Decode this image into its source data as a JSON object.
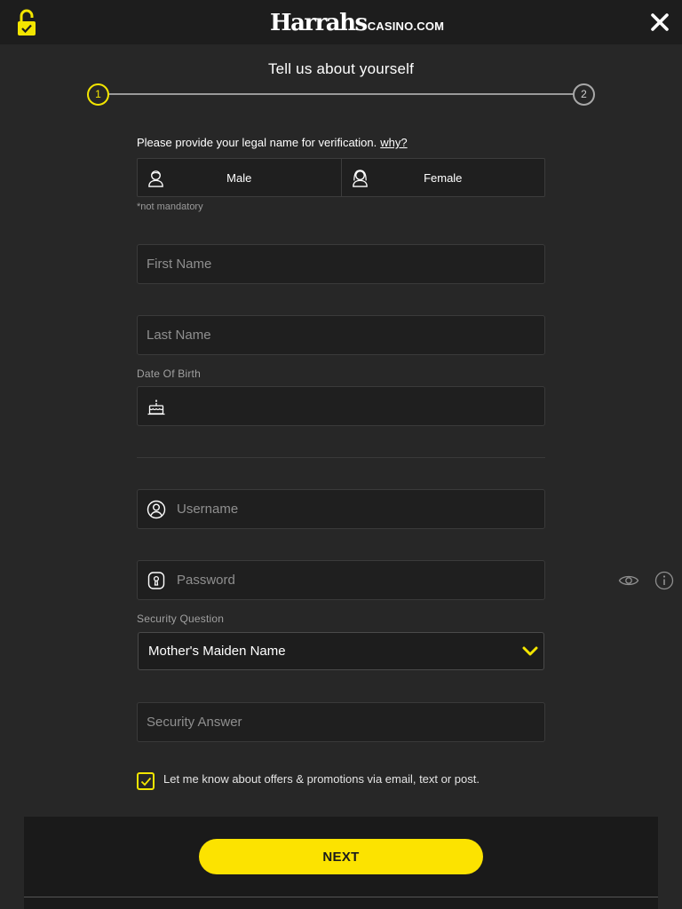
{
  "header": {
    "logo_main": "Harrahs",
    "logo_sub": "CASINO.COM",
    "icons": {
      "lock": "lock-check-icon",
      "close": "close-icon"
    },
    "colors": {
      "background": "#1d1d1d",
      "accent": "#f3e500"
    }
  },
  "stepper": {
    "title": "Tell us about yourself",
    "steps": [
      {
        "label": "1",
        "active": true
      },
      {
        "label": "2",
        "active": false
      }
    ]
  },
  "form": {
    "legal_text": "Please provide your legal name for verification.",
    "why_link": "why?",
    "gender": {
      "male": "Male",
      "female": "Female",
      "note": "*not mandatory"
    },
    "first_name": {
      "placeholder": "First Name",
      "value": ""
    },
    "last_name": {
      "placeholder": "Last Name",
      "value": ""
    },
    "dob": {
      "label": "Date Of Birth",
      "value": ""
    },
    "username": {
      "placeholder": "Username",
      "value": ""
    },
    "password": {
      "placeholder": "Password",
      "value": ""
    },
    "security_question": {
      "label": "Security Question",
      "selected": "Mother's Maiden Name"
    },
    "security_answer": {
      "placeholder": "Security Answer",
      "value": ""
    },
    "consent": {
      "text": "Let me know about offers & promotions via email, text or post.",
      "checked": true
    }
  },
  "footer": {
    "next_label": "NEXT"
  },
  "colors": {
    "page_bg": "#272727",
    "field_bg": "#1f1f1f",
    "button": "#fce300"
  }
}
